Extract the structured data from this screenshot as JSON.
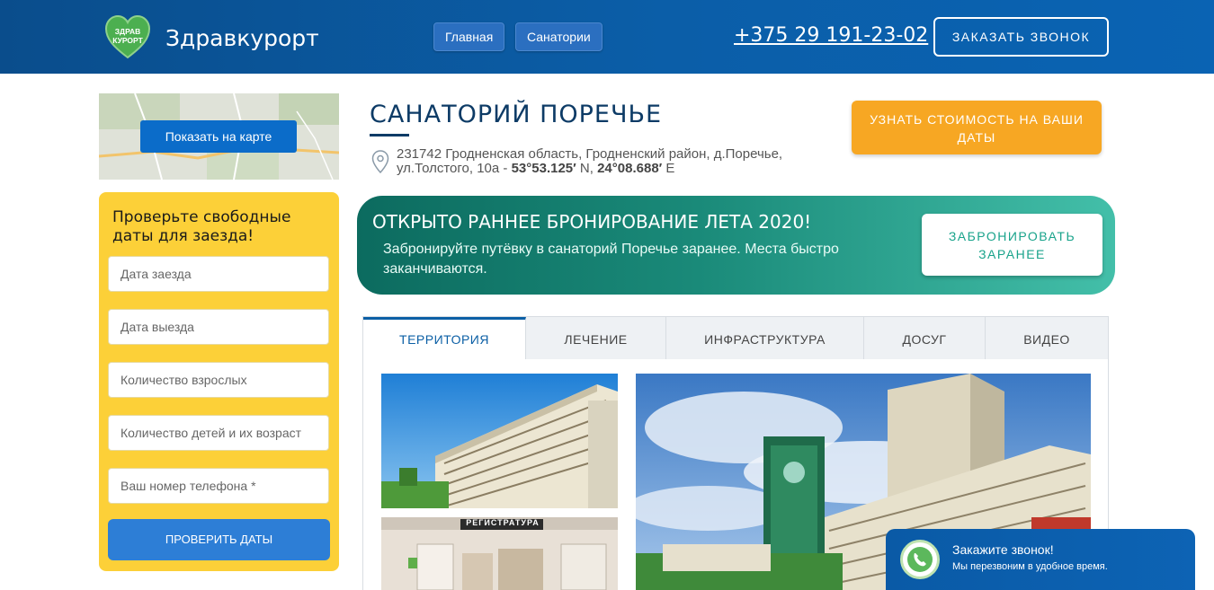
{
  "header": {
    "logo_text_top": "ЗДРАВ",
    "logo_text_bottom": "КУРОРТ",
    "brand": "Здравкурорт",
    "nav": [
      "Главная",
      "Санатории"
    ],
    "phone": "+375 29 191-23-02",
    "call_button": "ЗАКАЗАТЬ ЗВОНОК"
  },
  "map": {
    "button": "Показать на карте"
  },
  "check_dates": {
    "title": "Проверьте свободные даты для заезда!",
    "fields": [
      "Дата заезда",
      "Дата выезда",
      "Количество взрослых",
      "Количество детей и их возраст",
      "Ваш номер телефона *"
    ],
    "button": "ПРОВЕРИТЬ ДАТЫ"
  },
  "sanatorium": {
    "title": "САНАТОРИЙ ПОРЕЧЬЕ",
    "address": "231742 Гродненская область, Гродненский район, д.Поречье, ул.Толстого, 10а - ",
    "lat": "53°53.125′",
    "lat_dir": " N, ",
    "lon": "24°08.688′",
    "lon_dir": " E",
    "price_button": "УЗНАТЬ СТОИМОСТЬ НА ВАШИ ДАТЫ"
  },
  "banner": {
    "title": "ОТКРЫТО РАННЕЕ БРОНИРОВАНИЕ ЛЕТА 2020!",
    "text": "Забронируйте путёвку в санаторий Поречье заранее. Места быстро заканчиваются.",
    "button": "ЗАБРОНИРОВАТЬ ЗАРАНЕЕ"
  },
  "tabs": [
    "ТЕРРИТОРИЯ",
    "ЛЕЧЕНИЕ",
    "ИНФРАСТРУКТУРА",
    "ДОСУГ",
    "ВИДЕО"
  ],
  "photos": {
    "reception_sign": "РЕГИСТРАТУРА"
  },
  "callback": {
    "title": "Закажите звонок!",
    "text": "Мы перезвоним в удобное время."
  },
  "colors": {
    "header": "#0b5ea8",
    "accent_orange": "#f7a723",
    "check_yellow": "#fcd038",
    "banner_teal": "#1a8a79",
    "title_navy": "#0d3b66"
  }
}
